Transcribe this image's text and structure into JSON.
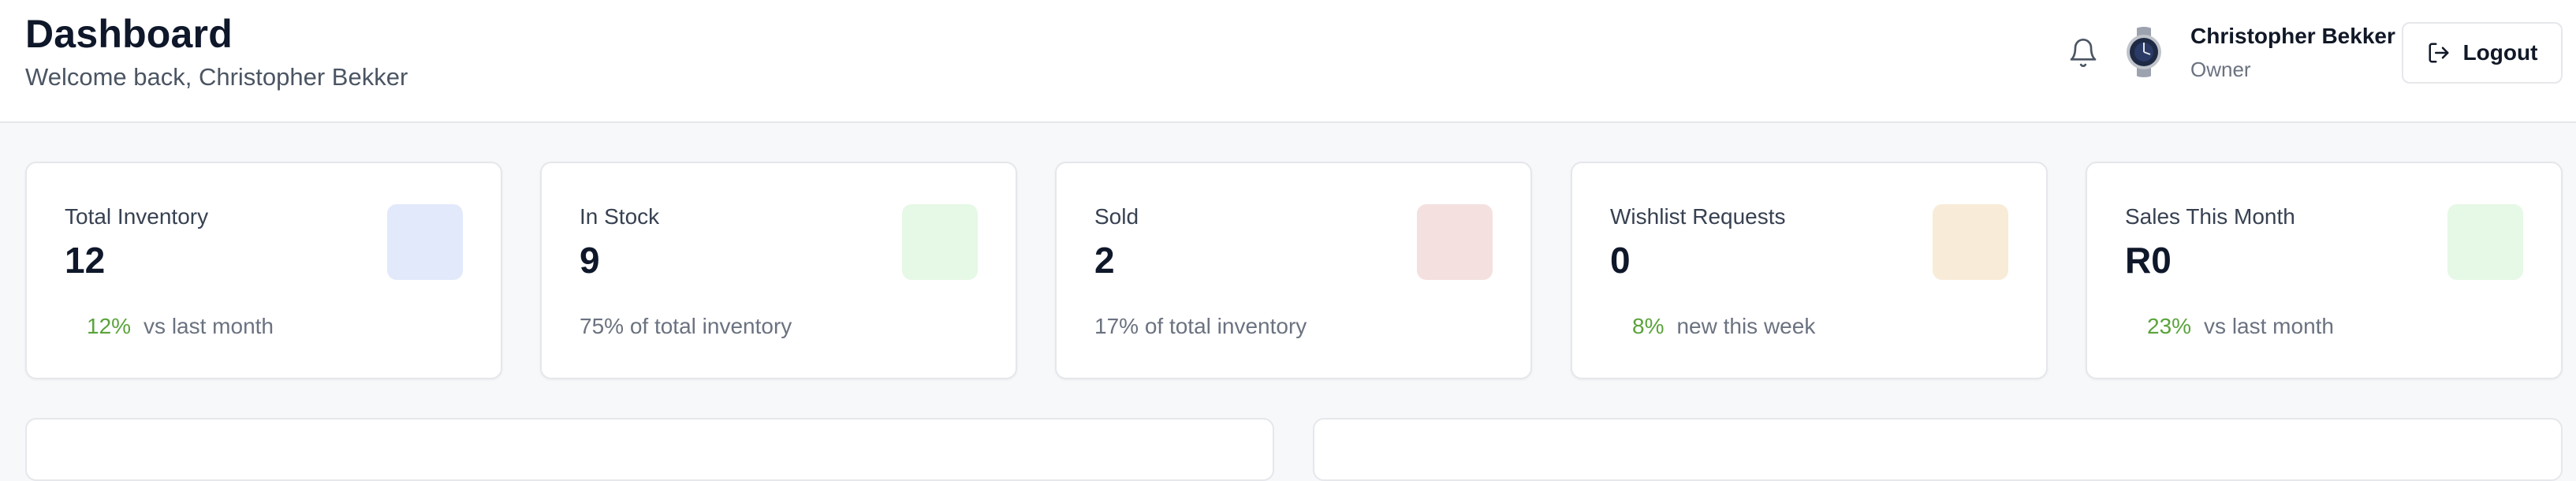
{
  "header": {
    "title": "Dashboard",
    "subtitle": "Welcome back, Christopher Bekker",
    "user": {
      "name": "Christopher Bekker",
      "role": "Owner"
    },
    "logout_label": "Logout",
    "icons": {
      "notifications": "bell-icon",
      "logout": "logout-icon"
    }
  },
  "stats": [
    {
      "title": "Total Inventory",
      "value": "12",
      "trend": "12%",
      "footer": "vs last month",
      "icon_color": "#e2e9fb"
    },
    {
      "title": "In Stock",
      "value": "9",
      "footer": "75% of total inventory",
      "icon_color": "#e6f8e6"
    },
    {
      "title": "Sold",
      "value": "2",
      "footer": "17% of total inventory",
      "icon_color": "#f4e1df"
    },
    {
      "title": "Wishlist Requests",
      "value": "0",
      "trend": "8%",
      "footer": "new this week",
      "icon_color": "#f8ecd8"
    },
    {
      "title": "Sales This Month",
      "value": "R0",
      "trend": "23%",
      "footer": "vs last month",
      "icon_color": "#e6f8e6"
    }
  ],
  "colors": {
    "trend_green": "#5aa33b",
    "border": "#e5e7eb",
    "background": "#f7f8fa"
  }
}
